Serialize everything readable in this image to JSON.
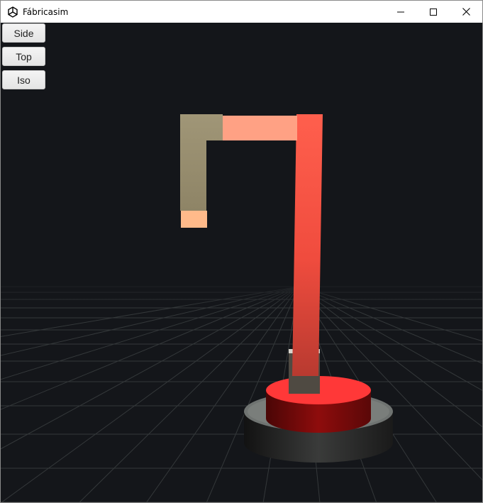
{
  "window": {
    "title": "Fábricasim",
    "app_icon": "unity-icon",
    "controls": [
      "minimize-icon",
      "maximize-icon",
      "close-icon"
    ]
  },
  "view_buttons": [
    {
      "label": "Side"
    },
    {
      "label": "Top"
    },
    {
      "label": "Iso"
    }
  ],
  "scene": {
    "background": "#14161a",
    "grid_color": "#3a3d40",
    "colors": {
      "base_ring": "#6f7371",
      "base_ring_side": "#2a2b2a",
      "turntable_top": "#ff3b3b",
      "turntable_side": "#7a0a0a",
      "column": "#ff5a4a",
      "upper_arm": "#ffa184",
      "forearm": "#9a8e70",
      "effector": "#ffba8a"
    }
  }
}
